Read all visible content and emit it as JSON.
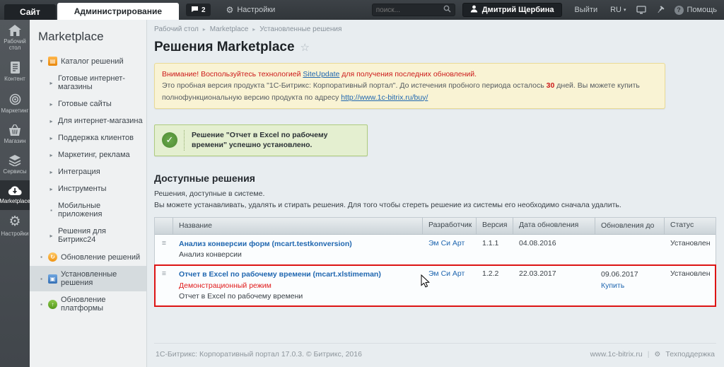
{
  "topbar": {
    "site_tab": "Сайт",
    "admin_tab": "Администрирование",
    "notify_count": "2",
    "settings_label": "Настройки",
    "search_placeholder": "поиск...",
    "user_name": "Дмитрий Щербина",
    "logout_label": "Выйти",
    "lang_label": "RU",
    "help_label": "Помощь",
    "help_q": "?"
  },
  "rail": {
    "items": [
      {
        "label": "Рабочий стол",
        "icon": "home-icon"
      },
      {
        "label": "Контент",
        "icon": "document-icon"
      },
      {
        "label": "Маркетинг",
        "icon": "target-icon"
      },
      {
        "label": "Магазин",
        "icon": "basket-icon"
      },
      {
        "label": "Сервисы",
        "icon": "layers-icon"
      },
      {
        "label": "Marketplace",
        "icon": "cloud-download-icon"
      },
      {
        "label": "Настройки",
        "icon": "gear-icon"
      }
    ]
  },
  "sidebar": {
    "title": "Marketplace",
    "items": [
      {
        "label": "Каталог решений",
        "marker": "▾"
      },
      {
        "label": "Готовые интернет-магазины",
        "marker": "▸"
      },
      {
        "label": "Готовые сайты",
        "marker": "▸"
      },
      {
        "label": "Для интернет-магазина",
        "marker": "▸"
      },
      {
        "label": "Поддержка клиентов",
        "marker": "▸"
      },
      {
        "label": "Маркетинг, реклама",
        "marker": "▸"
      },
      {
        "label": "Интеграция",
        "marker": "▸"
      },
      {
        "label": "Инструменты",
        "marker": "▸"
      },
      {
        "label": "Мобильные приложения",
        "marker": "▪"
      },
      {
        "label": "Решения для Битрикс24",
        "marker": "▸"
      },
      {
        "label": "Обновление решений",
        "marker": "▪"
      },
      {
        "label": "Установленные решения",
        "marker": "▪"
      },
      {
        "label": "Обновление платформы",
        "marker": "▪"
      }
    ]
  },
  "breadcrumb": {
    "items": [
      "Рабочий стол",
      "Marketplace",
      "Установленные решения"
    ],
    "separator": "▸"
  },
  "page": {
    "title": "Решения Marketplace",
    "star": "☆"
  },
  "warning": {
    "line1_prefix": "Внимание! Воспользуйтесь технологией ",
    "line1_link": "SiteUpdate",
    "line1_suffix": " для получения последних обновлений.",
    "line2_part1": "Это пробная версия продукта \"1С-Битрикс: Корпоративный портал\". До истечения пробного периода осталось ",
    "line2_days": "30",
    "line2_part2": " дней. Вы можете купить полнофункциональную версию продукта по адресу ",
    "line2_link": "http://www.1c-bitrix.ru/buy/"
  },
  "success": {
    "check": "✓",
    "text": "Решение \"Отчет в Excel по рабочему времени\" успешно установлено."
  },
  "section": {
    "heading": "Доступные решения",
    "desc1": "Решения, доступные в системе.",
    "desc2": "Вы можете устанавливать, удалять и стирать решения. Для того чтобы стереть решение из системы его необходимо сначала удалить."
  },
  "table": {
    "headers": [
      "Название",
      "Разработчик",
      "Версия",
      "Дата обновления",
      "Обновления до",
      "Статус"
    ],
    "handle_glyph": "≡",
    "rows": [
      {
        "name_link": "Анализ конверсии форм (mcart.testkonversion)",
        "demo": "",
        "name_sub": "Анализ конверсии",
        "developer": "Эм Си Арт",
        "version": "1.1.1",
        "updated": "04.08.2016",
        "until": "",
        "until_link": "",
        "status": "Установлен"
      },
      {
        "name_link": "Отчет в Excel по рабочему времени (mcart.xlstimeman)",
        "demo": "Демонстрационный режим",
        "name_sub": "Отчет в Excel по рабочему времени",
        "developer": "Эм Си Арт",
        "version": "1.2.2",
        "updated": "22.03.2017",
        "until": "09.06.2017",
        "until_link": "Купить",
        "status": "Установлен"
      }
    ]
  },
  "footer": {
    "copyright": "1С-Битрикс: Корпоративный портал 17.0.3. © Битрикс, 2016",
    "site_link": "www.1c-bitrix.ru",
    "separator": "|",
    "support_link": "Техподдержка"
  },
  "colors": {
    "link_blue": "#2067b0",
    "alert_red": "#cc1a1a",
    "success_green": "#5d9b42",
    "warning_bg": "#f9f3d4",
    "success_bg": "#e4efd0",
    "highlight_border": "#dd1414",
    "topbar_bg": "#34393d"
  }
}
